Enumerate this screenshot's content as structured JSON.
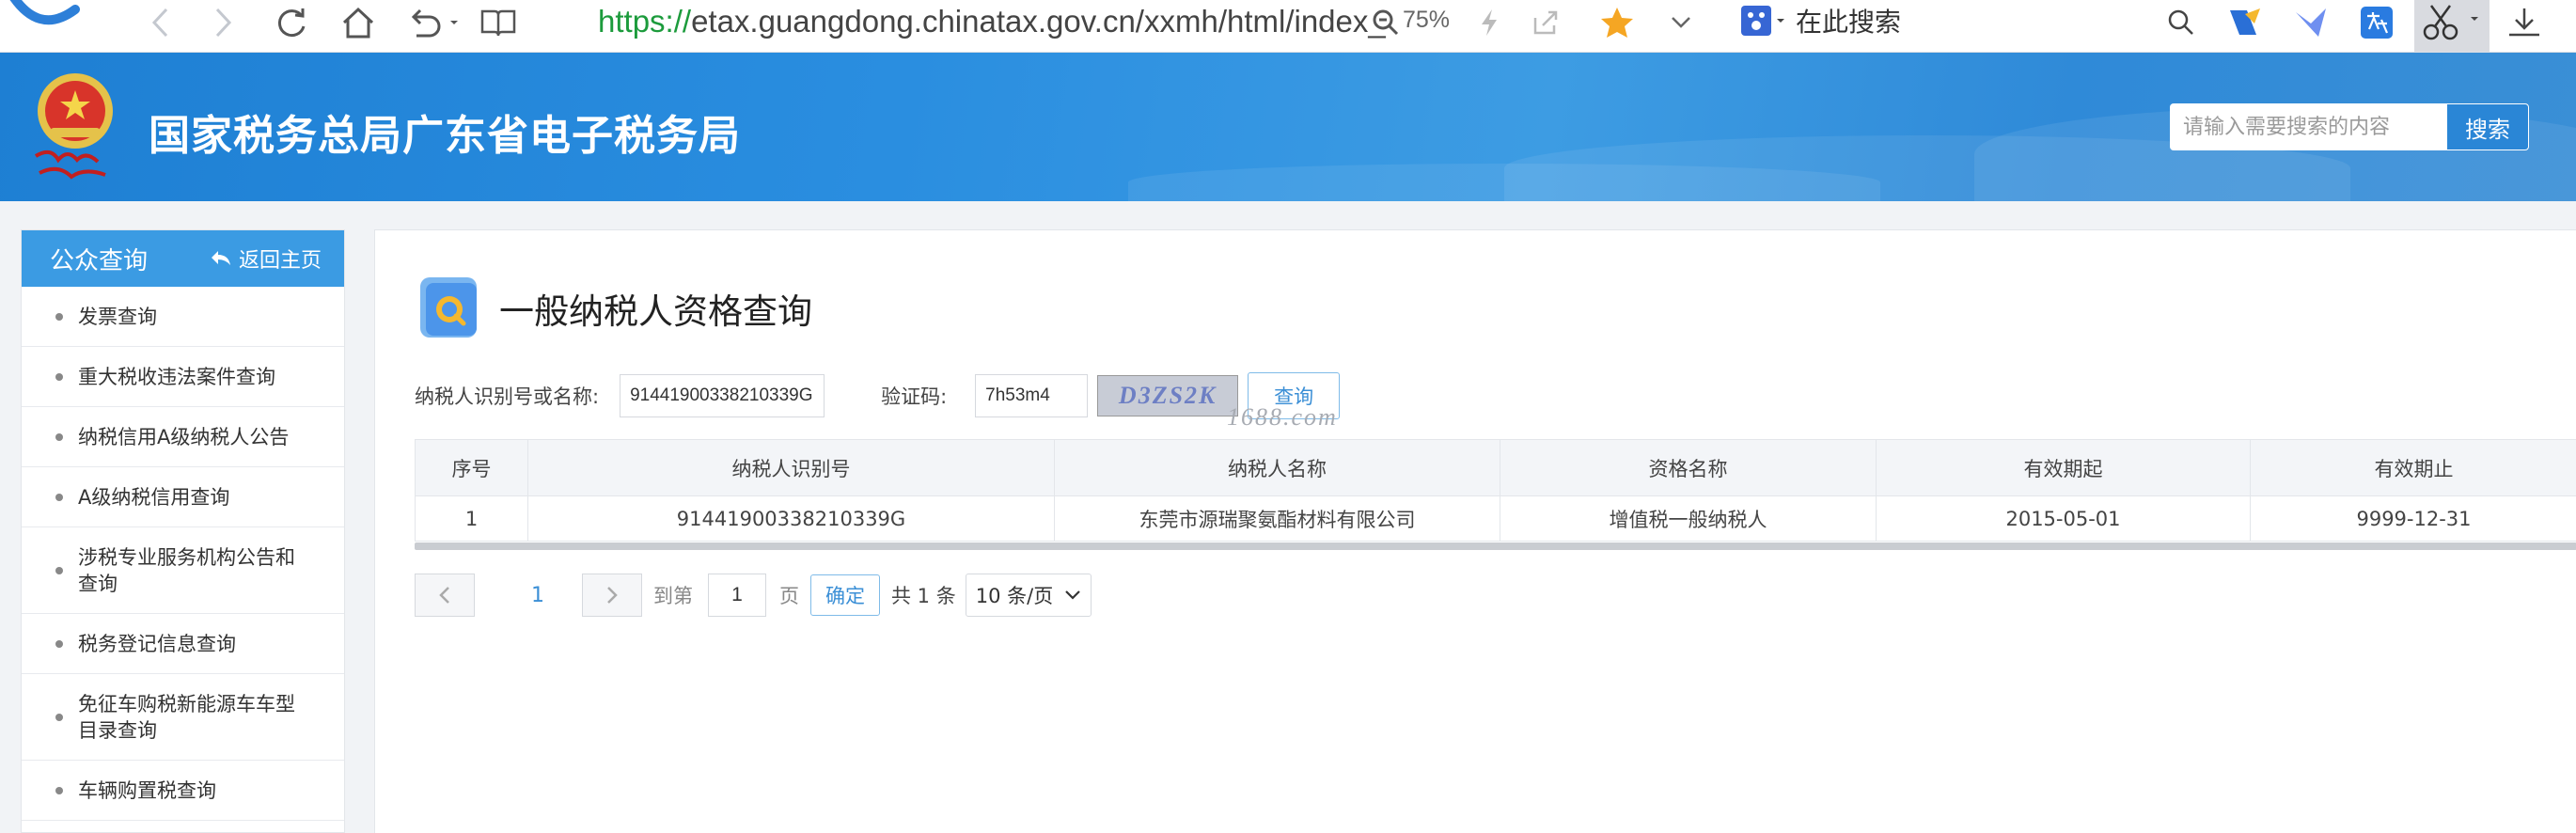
{
  "browser": {
    "url_scheme": "https://",
    "url_rest": "etax.guangdong.chinatax.gov.cn/xxmh/html/index_",
    "zoom": "75%",
    "search_placeholder": "在此搜索"
  },
  "header": {
    "site_title": "国家税务总局广东省电子税务局",
    "search_placeholder": "请输入需要搜索的内容",
    "search_button": "搜索",
    "brand_color": "#2a8ee0"
  },
  "sidebar": {
    "title": "公众查询",
    "back_label": "返回主页",
    "items": [
      {
        "label": "发票查询"
      },
      {
        "label": "重大税收违法案件查询"
      },
      {
        "label": "纳税信用A级纳税人公告"
      },
      {
        "label": "A级纳税信用查询"
      },
      {
        "label": "涉税专业服务机构公告和查询"
      },
      {
        "label": "税务登记信息查询"
      },
      {
        "label": "免征车购税新能源车车型目录查询"
      },
      {
        "label": "车辆购置税查询"
      }
    ]
  },
  "main": {
    "page_title": "一般纳税人资格查询",
    "form": {
      "taxpayer_label": "纳税人识别号或名称:",
      "taxpayer_value": "91441900338210339G",
      "captcha_label": "验证码:",
      "captcha_value": "7h53m4",
      "captcha_image_text": "D3ZS2K",
      "query_button": "查询"
    },
    "watermark": "1688.com",
    "table": {
      "headers": [
        "序号",
        "纳税人识别号",
        "纳税人名称",
        "资格名称",
        "有效期起",
        "有效期止"
      ],
      "rows": [
        [
          "1",
          "91441900338210339G",
          "东莞市源瑞聚氨酯材料有限公司",
          "增值税一般纳税人",
          "2015-05-01",
          "9999-12-31"
        ]
      ]
    },
    "pager": {
      "current_page": "1",
      "goto_label": "到第",
      "goto_value": "1",
      "page_unit": "页",
      "confirm": "确定",
      "total": "共 1 条",
      "page_size": "10 条/页"
    }
  }
}
